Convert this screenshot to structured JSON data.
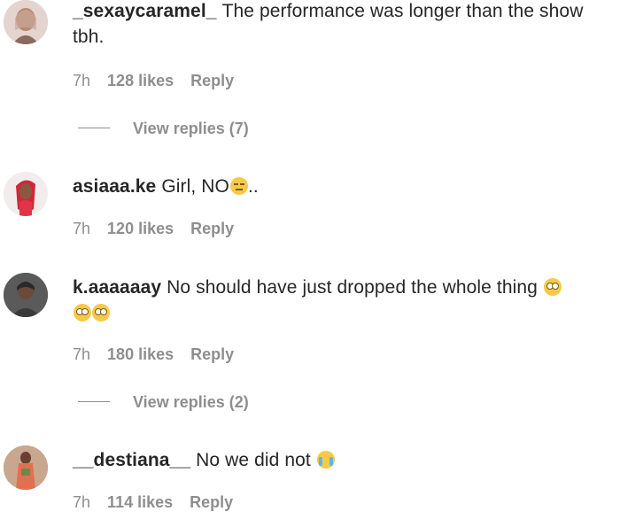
{
  "comments": [
    {
      "username": "_sexaycaramel_",
      "text": "The performance was longer than the show tbh.",
      "time": "7h",
      "likes": "128 likes",
      "reply": "Reply",
      "view_replies": "View replies (7)",
      "avatar_color": "#d9c5c0"
    },
    {
      "username": "asiaaa.ke",
      "text": "Girl, NO",
      "text_suffix": "..",
      "time": "7h",
      "likes": "120 likes",
      "reply": "Reply",
      "avatar_color": "#f0e8ea"
    },
    {
      "username": "k.aaaaaay",
      "text": "No should have just dropped the whole thing",
      "time": "7h",
      "likes": "180 likes",
      "reply": "Reply",
      "view_replies": "View replies (2)",
      "avatar_color": "#4a4a4a"
    },
    {
      "username": "__destiana__",
      "text": "No we did not",
      "time": "7h",
      "likes": "114 likes",
      "reply": "Reply",
      "avatar_color": "#b58a72"
    }
  ],
  "icons": {
    "eyes_emoji": "face-with-rolling-eyes-icon",
    "unamused_emoji": "unamused-face-icon",
    "cry_emoji": "loudly-crying-face-icon"
  }
}
